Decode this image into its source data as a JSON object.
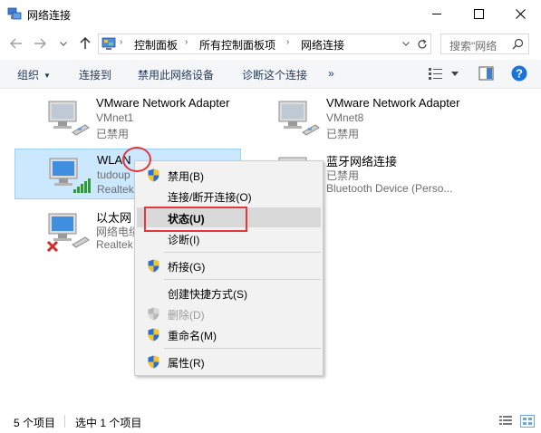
{
  "window": {
    "title": "网络连接"
  },
  "address": {
    "crumbs": [
      "控制面板",
      "所有控制面板项",
      "网络连接"
    ],
    "search_placeholder": "搜索\"网络"
  },
  "toolbar": {
    "organize": "组织",
    "connect_to": "连接到",
    "disable": "禁用此网络设备",
    "diagnose": "诊断这个连接",
    "more": "»"
  },
  "items": [
    {
      "name": "VMware Network Adapter",
      "line2": "VMnet1",
      "line3": "已禁用"
    },
    {
      "name": "VMware Network Adapter",
      "line2": "VMnet8",
      "line3": "已禁用"
    },
    {
      "name": "WLAN",
      "line2": "tudoup",
      "line3": "Realtek"
    },
    {
      "name": "蓝牙网络连接",
      "line2": "已禁用",
      "line3": "Bluetooth Device (Perso..."
    },
    {
      "name": "以太网",
      "line2": "网络电缆",
      "line3": "Realtek"
    }
  ],
  "context_menu": {
    "items": [
      {
        "label": "禁用(B)"
      },
      {
        "label": "连接/断开连接(O)"
      },
      {
        "label": "状态(U)"
      },
      {
        "label": "诊断(I)"
      },
      {
        "label": "桥接(G)"
      },
      {
        "label": "创建快捷方式(S)"
      },
      {
        "label": "删除(D)"
      },
      {
        "label": "重命名(M)"
      },
      {
        "label": "属性(R)"
      }
    ]
  },
  "status": {
    "item_count": "5 个项目",
    "selected": "选中 1 个项目"
  },
  "colors": {
    "selection_bg": "#cce8ff",
    "selection_border": "#99d1ff",
    "annotation": "#e0383b",
    "help_blue": "#1a73d9"
  }
}
